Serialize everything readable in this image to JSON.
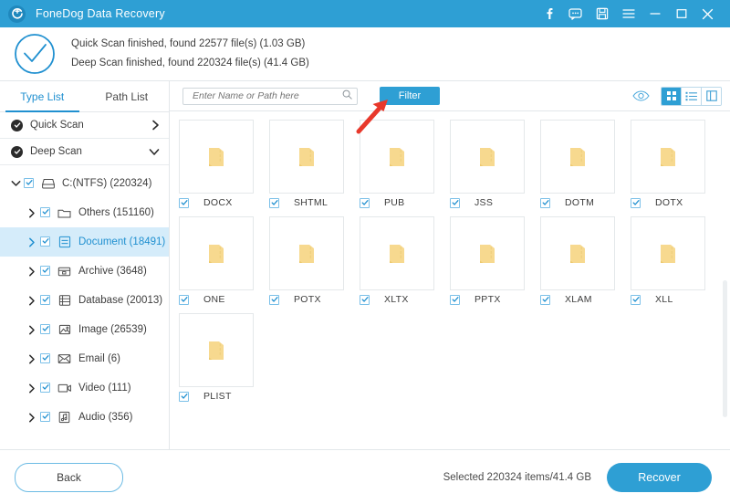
{
  "titlebar": {
    "app_title": "FoneDog Data Recovery",
    "logo_icon": "recovery-logo-icon",
    "buttons": [
      {
        "name": "facebook-icon",
        "glyph": "f"
      },
      {
        "name": "feedback-chat-icon",
        "glyph": "chat"
      },
      {
        "name": "save-icon",
        "glyph": "floppy"
      },
      {
        "name": "menu-icon",
        "glyph": "hamburger"
      },
      {
        "name": "minimize-icon",
        "glyph": "minimize"
      },
      {
        "name": "maximize-icon",
        "glyph": "maximize"
      },
      {
        "name": "close-icon",
        "glyph": "close"
      }
    ]
  },
  "summary": {
    "icon": "check-circle-icon",
    "line1": "Quick Scan finished, found 22577 file(s) (1.03 GB)",
    "line2": "Deep Scan finished, found 220324 file(s) (41.4 GB)"
  },
  "sidebar": {
    "tabs": [
      {
        "label": "Type List",
        "active": true
      },
      {
        "label": "Path List",
        "active": false
      }
    ],
    "scans": [
      {
        "label": "Quick Scan",
        "expanded": false,
        "chevron": "chevron-right-icon"
      },
      {
        "label": "Deep Scan",
        "expanded": true,
        "chevron": "chevron-down-icon"
      }
    ],
    "tree": [
      {
        "label": "C:(NTFS) (220324)",
        "icon": "drive-icon",
        "level": 0,
        "chevron": "chevron-down-icon",
        "checked": true,
        "selected": false
      },
      {
        "label": "Others (151160)",
        "icon": "folder-icon",
        "level": 1,
        "chevron": "chevron-right-icon",
        "checked": true,
        "selected": false
      },
      {
        "label": "Document (18491)",
        "icon": "document-icon",
        "level": 1,
        "chevron": "chevron-right-icon",
        "checked": true,
        "selected": true
      },
      {
        "label": "Archive (3648)",
        "icon": "archive-icon",
        "level": 1,
        "chevron": "chevron-right-icon",
        "checked": true,
        "selected": false
      },
      {
        "label": "Database (20013)",
        "icon": "database-icon",
        "level": 1,
        "chevron": "chevron-right-icon",
        "checked": true,
        "selected": false
      },
      {
        "label": "Image (26539)",
        "icon": "image-icon",
        "level": 1,
        "chevron": "chevron-right-icon",
        "checked": true,
        "selected": false
      },
      {
        "label": "Email (6)",
        "icon": "email-icon",
        "level": 1,
        "chevron": "chevron-right-icon",
        "checked": true,
        "selected": false
      },
      {
        "label": "Video (111)",
        "icon": "video-icon",
        "level": 1,
        "chevron": "chevron-right-icon",
        "checked": true,
        "selected": false
      },
      {
        "label": "Audio (356)",
        "icon": "audio-icon",
        "level": 1,
        "chevron": "chevron-right-icon",
        "checked": true,
        "selected": false
      }
    ]
  },
  "toolbar": {
    "search_placeholder": "Enter Name or Path here",
    "search_value": "",
    "search_icon": "search-icon",
    "filter_label": "Filter",
    "preview_icon": "eye-icon",
    "view_modes": [
      {
        "name": "grid-view-icon",
        "active": true
      },
      {
        "name": "list-view-icon",
        "active": false
      },
      {
        "name": "detail-view-icon",
        "active": false
      }
    ]
  },
  "grid": {
    "items": [
      {
        "label": "DOCX",
        "icon": "folder-icon",
        "checked": true
      },
      {
        "label": "SHTML",
        "icon": "folder-icon",
        "checked": true
      },
      {
        "label": "PUB",
        "icon": "folder-icon",
        "checked": true
      },
      {
        "label": "JSS",
        "icon": "folder-icon",
        "checked": true
      },
      {
        "label": "DOTM",
        "icon": "folder-icon",
        "checked": true
      },
      {
        "label": "DOTX",
        "icon": "folder-icon",
        "checked": true
      },
      {
        "label": "ONE",
        "icon": "folder-icon",
        "checked": true
      },
      {
        "label": "POTX",
        "icon": "folder-icon",
        "checked": true
      },
      {
        "label": "XLTX",
        "icon": "folder-icon",
        "checked": true
      },
      {
        "label": "PPTX",
        "icon": "folder-icon",
        "checked": true
      },
      {
        "label": "XLAM",
        "icon": "folder-icon",
        "checked": true
      },
      {
        "label": "XLL",
        "icon": "folder-icon",
        "checked": true
      },
      {
        "label": "PLIST",
        "icon": "folder-icon",
        "checked": true
      }
    ]
  },
  "footer": {
    "back_label": "Back",
    "selected_text": "Selected 220324 items/41.4 GB",
    "recover_label": "Recover"
  },
  "annotation": {
    "arrow": "red-arrow-pointing-to-filter-button"
  },
  "colors": {
    "brand_blue": "#2e9fd4",
    "selected_row": "#d5ecfa",
    "folder_yellow": "#f5d78e",
    "annotation_red": "#e8382b"
  }
}
